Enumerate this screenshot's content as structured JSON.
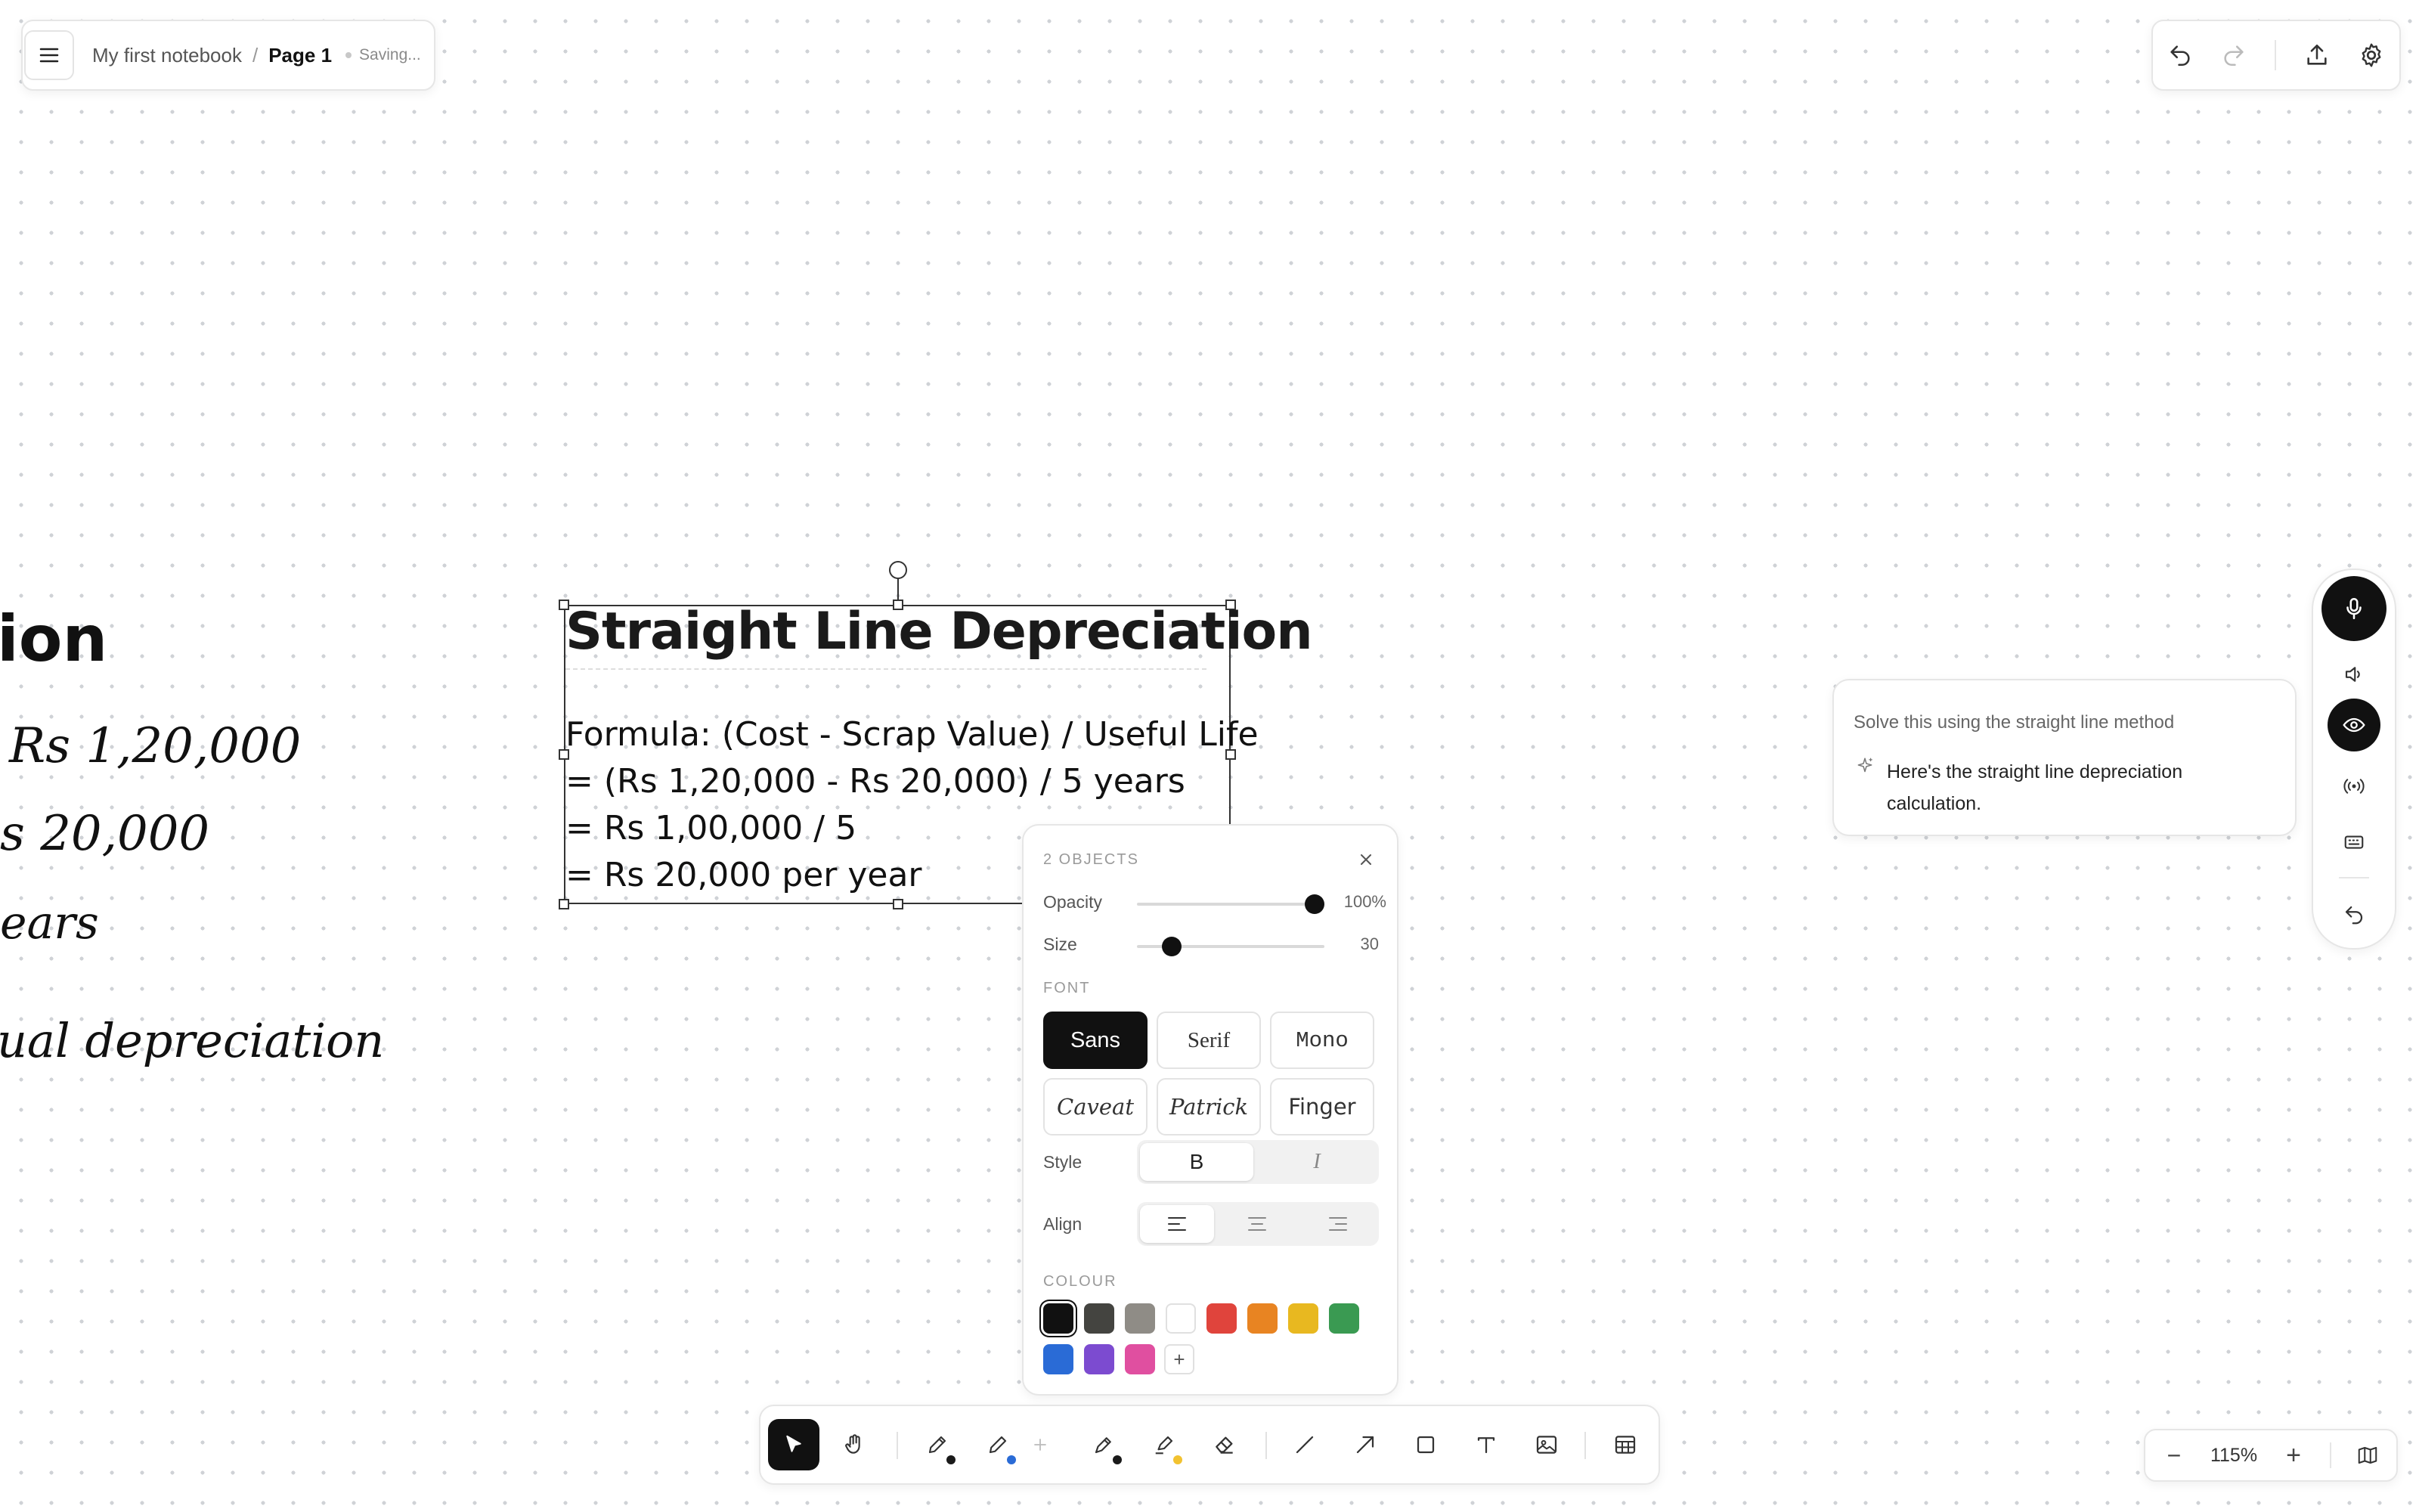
{
  "breadcrumb": {
    "notebook": "My first notebook",
    "separator": "/",
    "page": "Page 1",
    "status": "Saving..."
  },
  "canvas": {
    "left_handwriting": [
      "ion",
      "Rs 1,20,000",
      "s 20,000",
      "ears",
      "ual depreciation"
    ],
    "text_object": {
      "title": "Straight Line Depreciation",
      "lines": [
        "Formula: (Cost - Scrap Value) / Useful Life",
        "= (Rs 1,20,000 - Rs 20,000) / 5 years",
        "= Rs 1,00,000 / 5",
        "= Rs 20,000 per year"
      ]
    }
  },
  "panel": {
    "header": "2 OBJECTS",
    "opacity_label": "Opacity",
    "opacity_value": "100%",
    "opacity_fraction": 1.0,
    "size_label": "Size",
    "size_value": "30",
    "size_fraction": 0.15,
    "font_section": "FONT",
    "fonts": [
      "Sans",
      "Serif",
      "Mono",
      "Caveat",
      "Patrick",
      "Finger"
    ],
    "selected_font": "Sans",
    "style_label": "Style",
    "style_bold": "B",
    "style_italic": "I",
    "align_label": "Align",
    "colour_section": "COLOUR",
    "colours": [
      "#111111",
      "#444440",
      "#8f8c86",
      "#ffffff",
      "#e0443c",
      "#e88422",
      "#e8b820",
      "#3a9a52",
      "#2a6bd6",
      "#7c4bd0",
      "#e04fa0"
    ],
    "selected_colour": "#111111",
    "add_colour": "+"
  },
  "toolbar": {
    "tools": [
      "select",
      "hand",
      "pencil",
      "pen",
      "add",
      "marker",
      "highlighter",
      "eraser",
      "line",
      "arrow",
      "rectangle",
      "text",
      "image",
      "table"
    ],
    "active_tool": "select",
    "pencil_dot": "#1a1a1a",
    "pen_dot": "#2a6bd6",
    "marker_dot": "#1a1a1a",
    "highlighter_dot": "#f2c230"
  },
  "zoom": {
    "minus": "−",
    "value": "115%",
    "plus": "+"
  },
  "assistant": {
    "prompt": "Solve this using the straight line method",
    "answer": "Here's the straight line depreciation calculation."
  }
}
